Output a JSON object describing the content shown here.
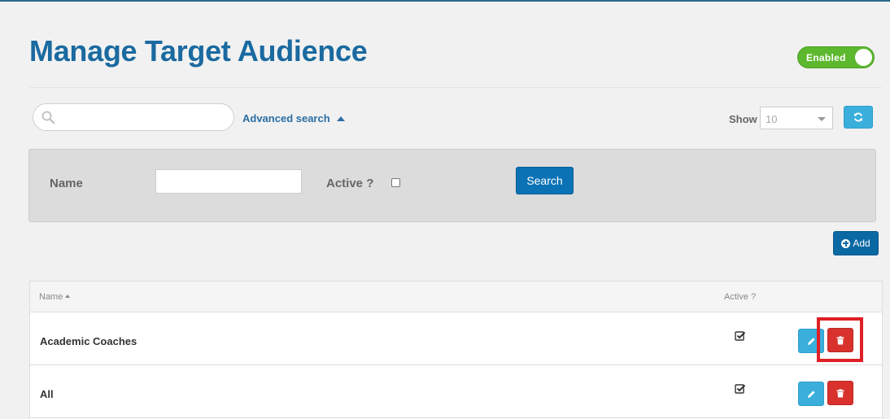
{
  "header": {
    "title": "Manage Target Audience",
    "toggle_label": "Enabled"
  },
  "toolbar": {
    "search_placeholder": "",
    "search_value": "",
    "advanced_search_label": "Advanced search",
    "show_label": "Show",
    "page_size": "10",
    "add_label": "Add"
  },
  "advanced_search": {
    "name_label": "Name",
    "name_value": "",
    "active_label": "Active ?",
    "search_button": "Search"
  },
  "table": {
    "columns": [
      "Name",
      "Active ?"
    ],
    "rows": [
      {
        "name": "Academic Coaches",
        "active": true
      },
      {
        "name": "All",
        "active": true
      }
    ]
  },
  "colors": {
    "title": "#1a6aa0",
    "toggle": "#5cb82e",
    "primary_button": "#0a72b5",
    "info_button": "#3bafdc",
    "danger_button": "#d9312c",
    "highlight": "#e01f26"
  },
  "icons": [
    "search-icon",
    "caret-up-icon",
    "refresh-icon",
    "plus-circle-icon",
    "sort-asc-icon",
    "check-icon",
    "pencil-icon",
    "trash-icon"
  ]
}
